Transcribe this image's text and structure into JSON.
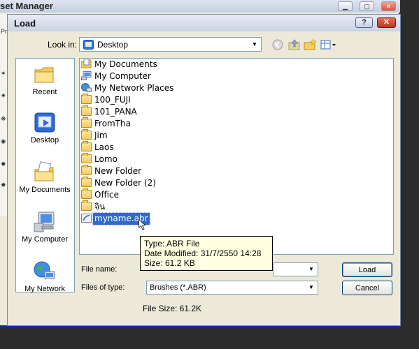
{
  "background_window": {
    "title": "set Manager",
    "minimize_glyph": "▁",
    "maximize_glyph": "▢",
    "close_glyph": "✕"
  },
  "dialog": {
    "title": "Load",
    "help_glyph": "?",
    "close_glyph": "✕"
  },
  "look_in": {
    "label": "Look in:",
    "value": "Desktop",
    "icons": [
      "back-icon",
      "up-folder-icon",
      "new-folder-icon",
      "view-menu-icon"
    ]
  },
  "places": [
    {
      "label": "Recent",
      "icon": "recent-folder-icon"
    },
    {
      "label": "Desktop",
      "icon": "desktop-icon"
    },
    {
      "label": "My Documents",
      "icon": "my-documents-icon"
    },
    {
      "label": "My Computer",
      "icon": "my-computer-icon"
    },
    {
      "label": "My Network",
      "icon": "my-network-icon"
    }
  ],
  "files": [
    {
      "name": "My Documents",
      "icon": "documents-icon"
    },
    {
      "name": "My Computer",
      "icon": "computer-icon"
    },
    {
      "name": "My Network Places",
      "icon": "network-icon"
    },
    {
      "name": "100_FUJI",
      "icon": "folder-icon"
    },
    {
      "name": "101_PANA",
      "icon": "folder-icon"
    },
    {
      "name": "FromTha",
      "icon": "folder-icon"
    },
    {
      "name": "Jim",
      "icon": "folder-icon"
    },
    {
      "name": "Laos",
      "icon": "folder-icon"
    },
    {
      "name": "Lomo",
      "icon": "folder-icon"
    },
    {
      "name": "New Folder",
      "icon": "folder-icon"
    },
    {
      "name": "New Folder (2)",
      "icon": "folder-icon"
    },
    {
      "name": "Office",
      "icon": "folder-icon"
    },
    {
      "name": "จิน",
      "icon": "folder-icon"
    },
    {
      "name": "myname.abr",
      "icon": "abr-file-icon",
      "selected": true
    }
  ],
  "tooltip": {
    "type": "Type: ABR File",
    "modified": "Date Modified: 31/7/2550 14:28",
    "size": "Size: 61.2 KB"
  },
  "file_name": {
    "label": "File name:",
    "value": ""
  },
  "files_of_type": {
    "label": "Files of type:",
    "value": "Brushes (*.ABR)"
  },
  "buttons": {
    "load": "Load",
    "cancel": "Cancel"
  },
  "file_size": "File Size: 61.2K",
  "colors": {
    "selection": "#316ac5",
    "tooltip_bg": "#ffffe1",
    "dialog_bg": "#ece9d8"
  }
}
